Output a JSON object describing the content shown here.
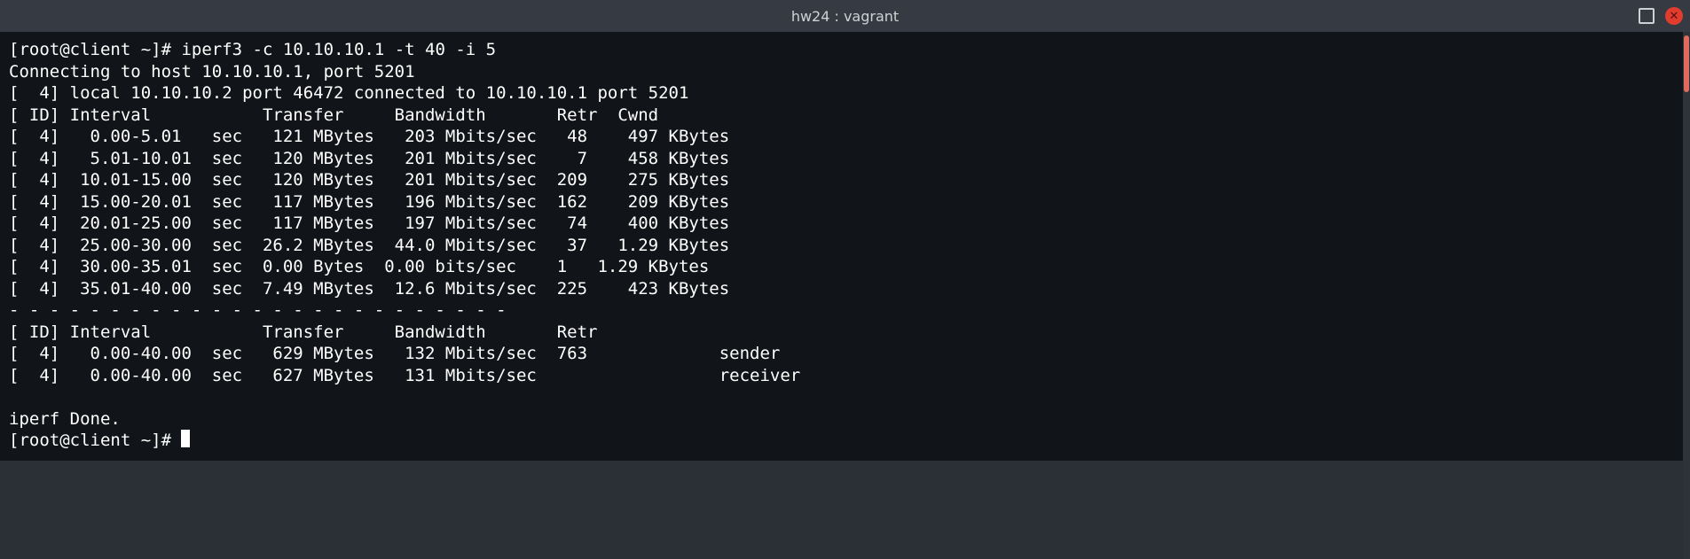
{
  "title": "hw24 : vagrant",
  "prompt_user_host": "[root@client ~]#",
  "command": "iperf3 -c 10.10.10.1 -t 40 -i 5",
  "connecting_line": "Connecting to host 10.10.10.1, port 5201",
  "local_line": "[  4] local 10.10.10.2 port 46472 connected to 10.10.10.1 port 5201",
  "header_line": "[ ID] Interval           Transfer     Bandwidth       Retr  Cwnd",
  "rows": [
    {
      "id": "4",
      "interval": "0.00-5.01",
      "sec": "sec",
      "transfer": "121 MBytes",
      "bandwidth": "203 Mbits/sec",
      "retr": "48",
      "cwnd": "497 KBytes"
    },
    {
      "id": "4",
      "interval": "5.01-10.01",
      "sec": "sec",
      "transfer": "120 MBytes",
      "bandwidth": "201 Mbits/sec",
      "retr": "7",
      "cwnd": "458 KBytes"
    },
    {
      "id": "4",
      "interval": "10.01-15.00",
      "sec": "sec",
      "transfer": "120 MBytes",
      "bandwidth": "201 Mbits/sec",
      "retr": "209",
      "cwnd": "275 KBytes"
    },
    {
      "id": "4",
      "interval": "15.00-20.01",
      "sec": "sec",
      "transfer": "117 MBytes",
      "bandwidth": "196 Mbits/sec",
      "retr": "162",
      "cwnd": "209 KBytes"
    },
    {
      "id": "4",
      "interval": "20.01-25.00",
      "sec": "sec",
      "transfer": "117 MBytes",
      "bandwidth": "197 Mbits/sec",
      "retr": "74",
      "cwnd": "400 KBytes"
    },
    {
      "id": "4",
      "interval": "25.00-30.00",
      "sec": "sec",
      "transfer": "26.2 MBytes",
      "bandwidth": "44.0 Mbits/sec",
      "retr": "37",
      "cwnd": "1.29 KBytes"
    },
    {
      "id": "4",
      "interval": "30.00-35.01",
      "sec": "sec",
      "transfer": "0.00 Bytes",
      "bandwidth": "0.00 bits/sec",
      "retr": "1",
      "cwnd": "1.29 KBytes"
    },
    {
      "id": "4",
      "interval": "35.01-40.00",
      "sec": "sec",
      "transfer": "7.49 MBytes",
      "bandwidth": "12.6 Mbits/sec",
      "retr": "225",
      "cwnd": "423 KBytes"
    }
  ],
  "separator_line": "- - - - - - - - - - - - - - - - - - - - - - - - -",
  "summary_header": "[ ID] Interval           Transfer     Bandwidth       Retr",
  "summary_rows": [
    {
      "id": "4",
      "interval": "0.00-40.00",
      "sec": "sec",
      "transfer": "629 MBytes",
      "bandwidth": "132 Mbits/sec",
      "retr": "763",
      "role": "sender"
    },
    {
      "id": "4",
      "interval": "0.00-40.00",
      "sec": "sec",
      "transfer": "627 MBytes",
      "bandwidth": "131 Mbits/sec",
      "retr": "",
      "role": "receiver"
    }
  ],
  "done_line": "iperf Done.",
  "row_lines": [
    "[  4]   0.00-5.01   sec   121 MBytes   203 Mbits/sec   48    497 KBytes",
    "[  4]   5.01-10.01  sec   120 MBytes   201 Mbits/sec    7    458 KBytes",
    "[  4]  10.01-15.00  sec   120 MBytes   201 Mbits/sec  209    275 KBytes",
    "[  4]  15.00-20.01  sec   117 MBytes   196 Mbits/sec  162    209 KBytes",
    "[  4]  20.01-25.00  sec   117 MBytes   197 Mbits/sec   74    400 KBytes",
    "[  4]  25.00-30.00  sec  26.2 MBytes  44.0 Mbits/sec   37   1.29 KBytes",
    "[  4]  30.00-35.01  sec  0.00 Bytes  0.00 bits/sec    1   1.29 KBytes",
    "[  4]  35.01-40.00  sec  7.49 MBytes  12.6 Mbits/sec  225    423 KBytes"
  ],
  "summary_lines": [
    "[  4]   0.00-40.00  sec   629 MBytes   132 Mbits/sec  763             sender",
    "[  4]   0.00-40.00  sec   627 MBytes   131 Mbits/sec                  receiver"
  ]
}
